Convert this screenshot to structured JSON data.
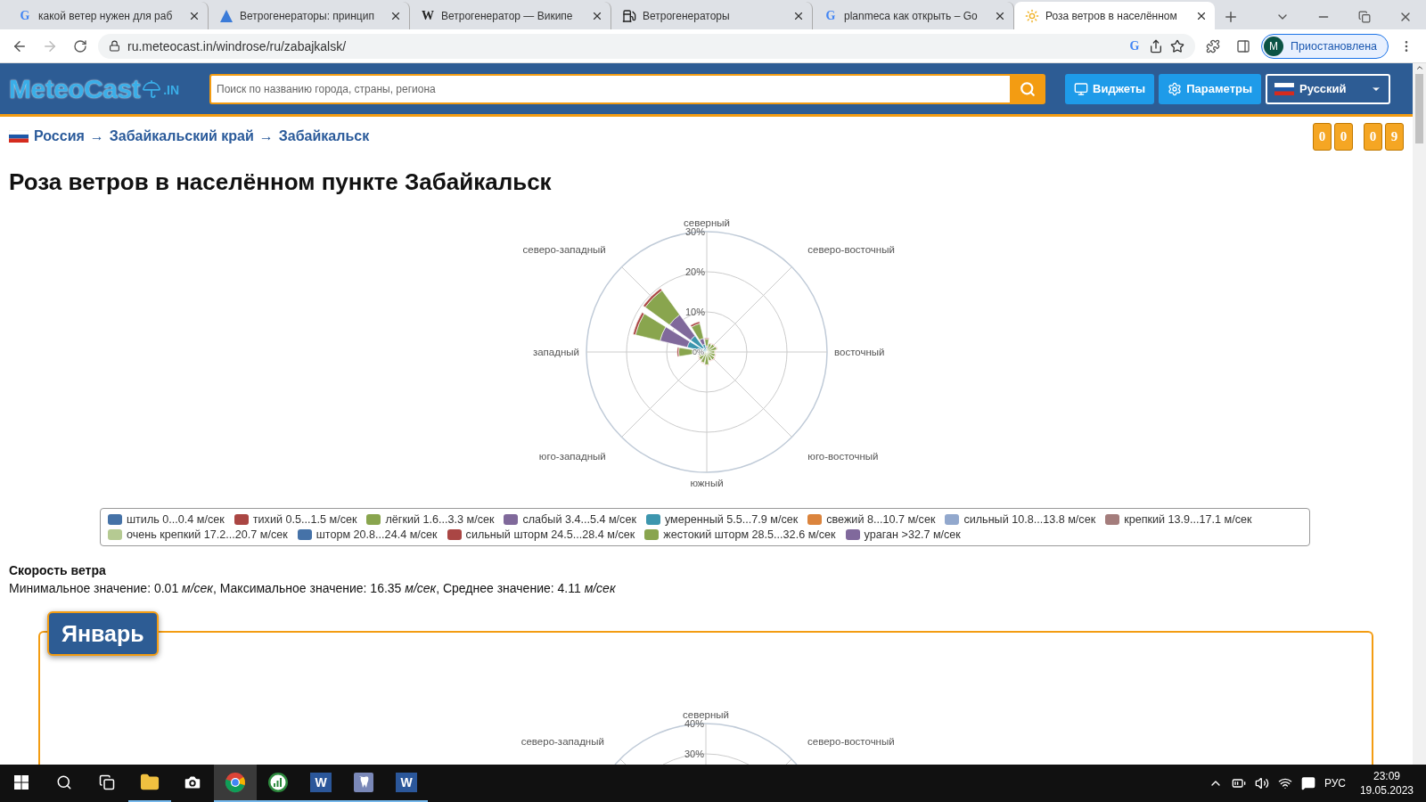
{
  "browser": {
    "tabs": [
      {
        "title": "какой ветер нужен для раб",
        "kind": "google",
        "glyph": "G",
        "selected": false
      },
      {
        "title": "Ветрогенераторы: принцип",
        "kind": "triangle",
        "selected": false
      },
      {
        "title": "Ветрогенератор — Википе",
        "kind": "wiki",
        "glyph": "W",
        "selected": false
      },
      {
        "title": "Ветрогенераторы",
        "kind": "fuel",
        "selected": false
      },
      {
        "title": "planmeca как открыть – Go",
        "kind": "google",
        "glyph": "G",
        "selected": false
      },
      {
        "title": "Роза ветров в населённом",
        "kind": "sun",
        "selected": true
      }
    ],
    "address": "ru.meteocast.in/windrose/ru/zabajkalsk/",
    "address_glyph": "G",
    "profile": {
      "initial": "M",
      "status": "Приостановлена"
    }
  },
  "site": {
    "logo": {
      "text": "MeteoCast",
      "suffix": ".IN"
    },
    "search": {
      "placeholder": "Поиск по названию города, страны, региона"
    },
    "buttons": [
      {
        "kind": "widgets",
        "label": "Виджеты"
      },
      {
        "kind": "settings",
        "label": "Параметры"
      }
    ],
    "language": "Русский"
  },
  "breadcrumb": {
    "items": [
      "Россия",
      "Забайкальский край",
      "Забайкальск"
    ],
    "separator": "→"
  },
  "counters": [
    [
      "0",
      "0"
    ],
    [
      "0",
      "9"
    ]
  ],
  "title": "Роза ветров в населённом пункте Забайкальск",
  "rose": {
    "directions": [
      "северный",
      "северо-западный",
      "северо-восточный",
      "западный",
      "восточный",
      "юго-западный",
      "юго-восточный",
      "южный"
    ],
    "ticks": [
      "30%",
      "20%",
      "10%"
    ],
    "center_tick": "0%"
  },
  "legend": [
    {
      "label": "штиль 0...0.4 м/сек",
      "color": "#4572a7"
    },
    {
      "label": "тихий 0.5...1.5 м/сек",
      "color": "#aa4643"
    },
    {
      "label": "лёгкий 1.6...3.3 м/сек",
      "color": "#89a54e"
    },
    {
      "label": "слабый 3.4...5.4 м/сек",
      "color": "#80699b"
    },
    {
      "label": "умеренный 5.5...7.9 м/сек",
      "color": "#3d96ae"
    },
    {
      "label": "свежий 8...10.7 м/сек",
      "color": "#db843d"
    },
    {
      "label": "сильный 10.8...13.8 м/сек",
      "color": "#92a8cd"
    },
    {
      "label": "крепкий 13.9...17.1 м/сек",
      "color": "#a47d7c"
    },
    {
      "label": "очень крепкий 17.2...20.7 м/сек",
      "color": "#b5ca92"
    },
    {
      "label": "шторм 20.8...24.4 м/сек",
      "color": "#4572a8"
    },
    {
      "label": "сильный шторм 24.5...28.4 м/сек",
      "color": "#aa4644"
    },
    {
      "label": "жестокий шторм 28.5...32.6 м/сек",
      "color": "#89a54f"
    },
    {
      "label": "ураган >32.7 м/сек",
      "color": "#80699c"
    }
  ],
  "speed": {
    "heading": "Скорость ветра",
    "text": "Минимальное значение: 0.01 *м/сек*, Максимальное значение: 16.35 *м/сек*, Среднее значение: 4.11 *м/сек*"
  },
  "months": [
    {
      "name": "Январь",
      "rose": {
        "directions": [
          "северный",
          "северо-западный",
          "северо-восточный"
        ],
        "ticks": [
          "40%",
          "30%"
        ]
      }
    }
  ],
  "taskbar": {
    "apps": [
      {
        "kind": "start",
        "selected": false,
        "running": false
      },
      {
        "kind": "search",
        "selected": false,
        "running": false
      },
      {
        "kind": "taskview",
        "selected": false,
        "running": false
      },
      {
        "kind": "folder",
        "selected": false,
        "running": true
      },
      {
        "kind": "camera",
        "selected": false,
        "running": false
      },
      {
        "kind": "chrome",
        "selected": true,
        "running": true
      },
      {
        "kind": "chart",
        "selected": false,
        "running": true
      },
      {
        "kind": "word",
        "glyph": "W",
        "selected": false,
        "running": true
      },
      {
        "kind": "tooth",
        "selected": false,
        "running": true
      },
      {
        "kind": "word",
        "glyph": "W",
        "selected": false,
        "running": true
      }
    ],
    "language": "РУС",
    "time": "23:09",
    "date": "19.05.2023"
  }
}
